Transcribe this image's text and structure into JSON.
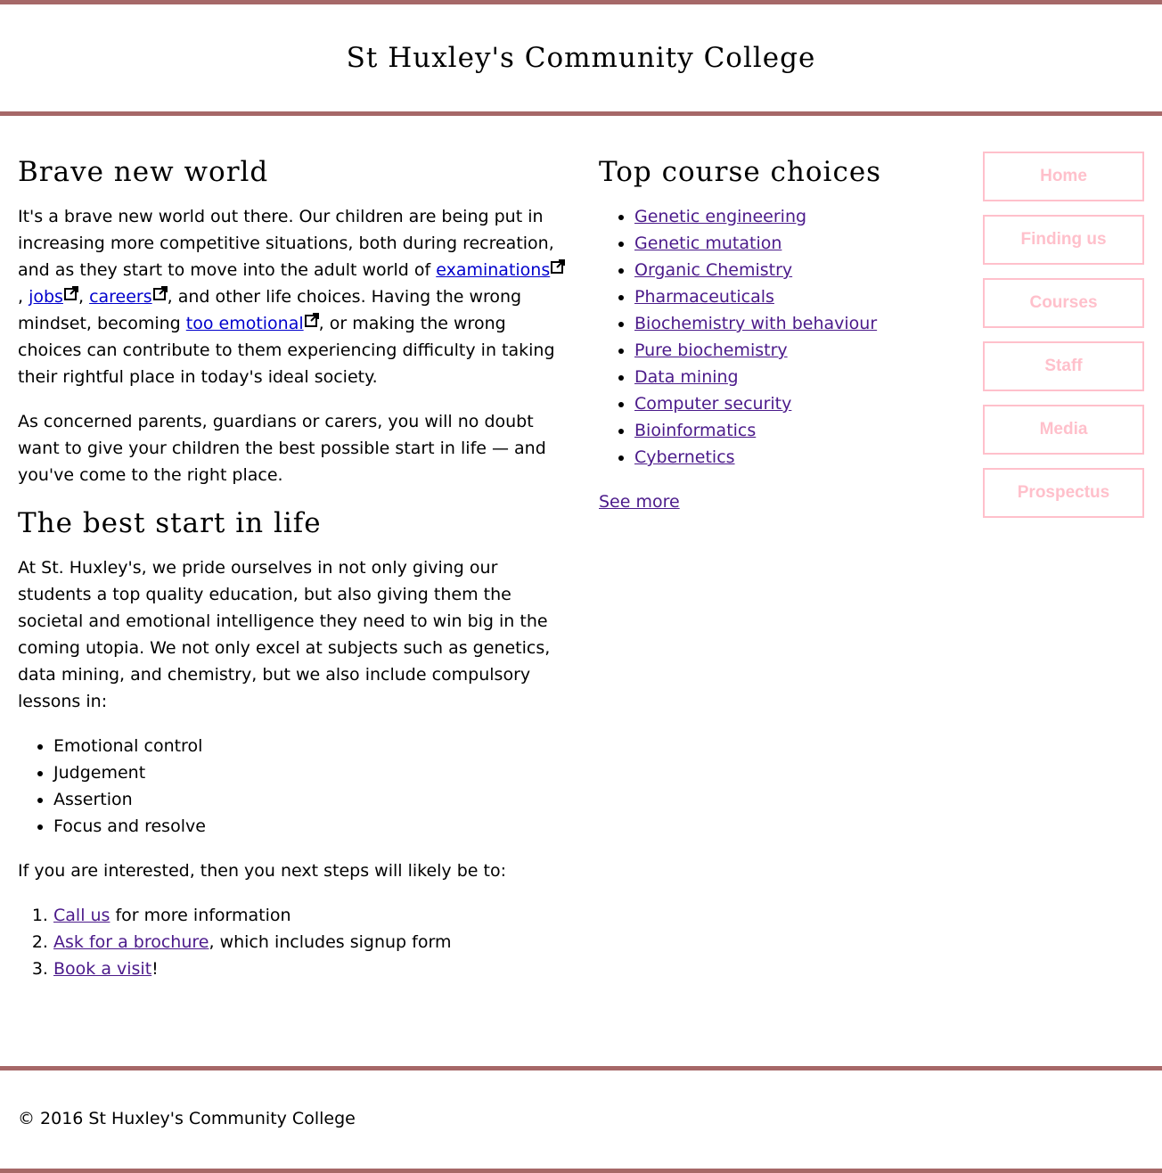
{
  "header": {
    "title": "St Huxley's Community College"
  },
  "left": {
    "section1": {
      "heading": "Brave new world",
      "p1_start": "It's a brave new world out there. Our children are being put in increasing more competitive situations, both during recreation, and as they start to move into the adult world of ",
      "link_examinations": "examinations",
      "sep1": ", ",
      "link_jobs": "jobs",
      "sep2": ", ",
      "link_careers": "careers",
      "p1_mid": ", and other life choices. Having the wrong mindset, becoming ",
      "link_too_emotional": "too emotional",
      "p1_end": ", or making the wrong choices can contribute to them experiencing difficulty in taking their rightful place in today's ideal society.",
      "p2": "As concerned parents, guardians or carers, you will no doubt want to give your children the best possible start in life — and you've come to the right place."
    },
    "section2": {
      "heading": "The best start in life",
      "p1": "At St. Huxley's, we pride ourselves in not only giving our students a top quality education, but also giving them the societal and emotional intelligence they need to win big in the coming utopia. We not only excel at subjects such as genetics, data mining, and chemistry, but we also include compulsory lessons in:",
      "lessons": [
        "Emotional control",
        "Judgement",
        "Assertion",
        "Focus and resolve"
      ],
      "p2": "If you are interested, then you next steps will likely be to:",
      "steps": [
        {
          "link": "Call us",
          "rest": " for more information"
        },
        {
          "link": "Ask for a brochure",
          "rest": ", which includes signup form"
        },
        {
          "link": "Book a visit",
          "rest": "!"
        }
      ]
    }
  },
  "courses": {
    "heading": "Top course choices",
    "items": [
      "Genetic engineering",
      "Genetic mutation",
      "Organic Chemistry",
      "Pharmaceuticals",
      "Biochemistry with behaviour",
      "Pure biochemistry",
      "Data mining",
      "Computer security",
      "Bioinformatics",
      "Cybernetics"
    ],
    "see_more": "See more"
  },
  "nav": {
    "items": [
      "Home",
      "Finding us",
      "Courses",
      "Staff",
      "Media",
      "Prospectus"
    ]
  },
  "footer": {
    "copyright": "© 2016 St Huxley's Community College"
  },
  "colors": {
    "accent_bar": "#a66868",
    "nav_border": "#ffc0cb",
    "link": "#4b1a8a",
    "external_link": "#0000cc"
  }
}
